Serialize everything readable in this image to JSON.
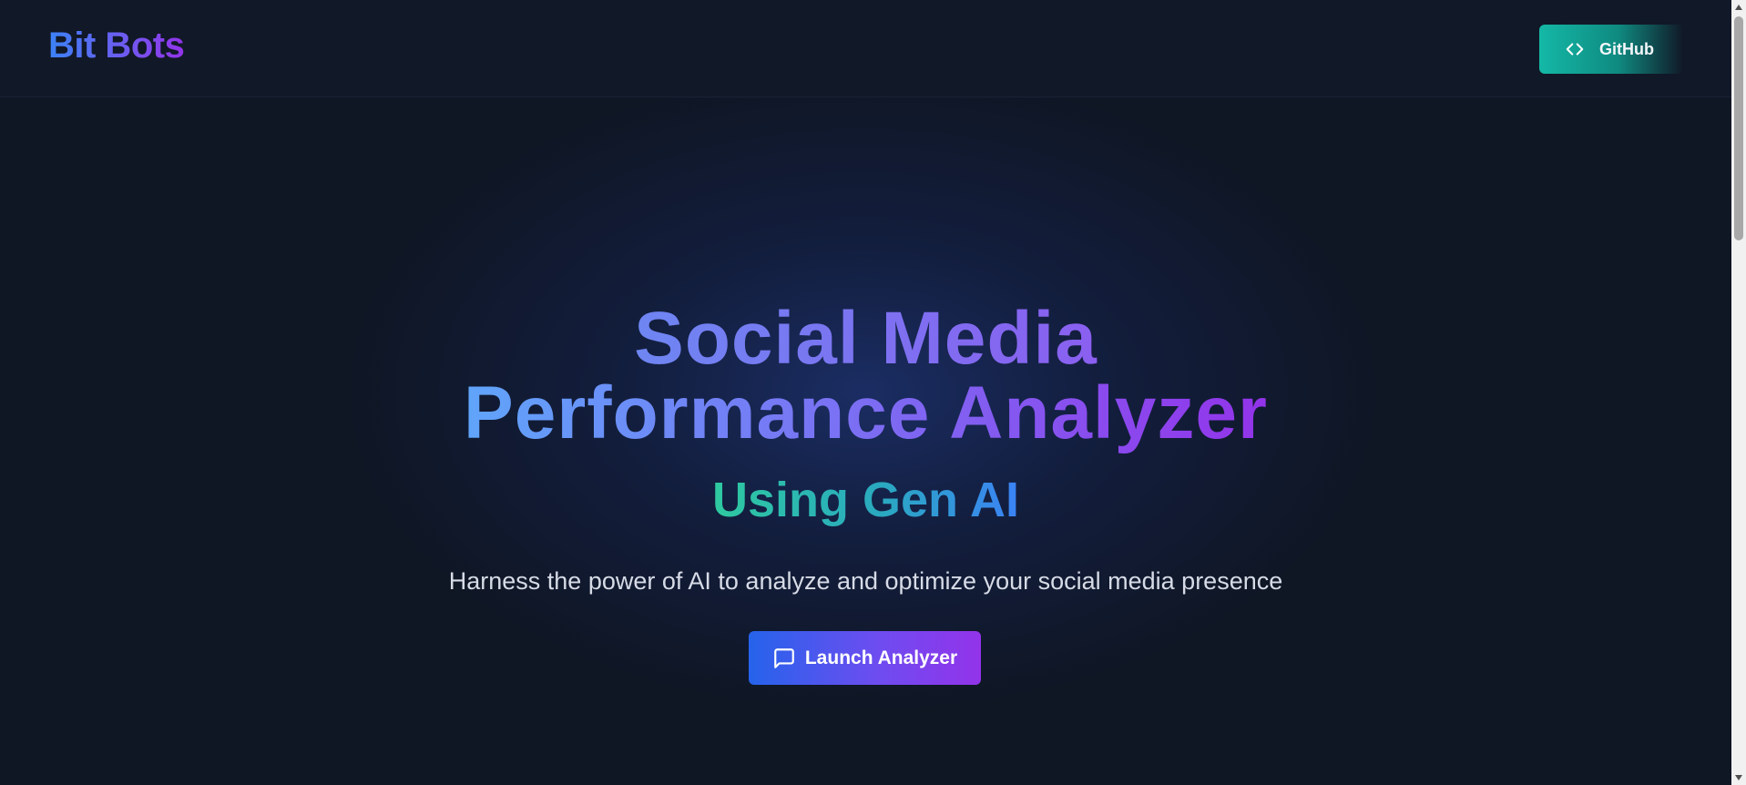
{
  "header": {
    "logo_text": "Bit Bots",
    "github_button": {
      "label": "GitHub",
      "icon": "code-brackets-icon"
    }
  },
  "hero": {
    "title_line1": "Social Media",
    "title_line2": "Performance Analyzer",
    "subtitle": "Using Gen AI",
    "tagline": "Harness the power of AI to analyze and optimize your social media presence",
    "launch_button": {
      "label": "Launch Analyzer",
      "icon": "message-square-icon"
    }
  },
  "colors": {
    "background": "#0f1624",
    "header_background": "#111827",
    "brand_gradient_start": "#3b82f6",
    "brand_gradient_end": "#9333ea",
    "subtitle_gradient_start": "#2ec9a0",
    "subtitle_gradient_end": "#3b82f6",
    "github_button": "#14b8a6",
    "tagline_text": "#d6dbe6"
  }
}
